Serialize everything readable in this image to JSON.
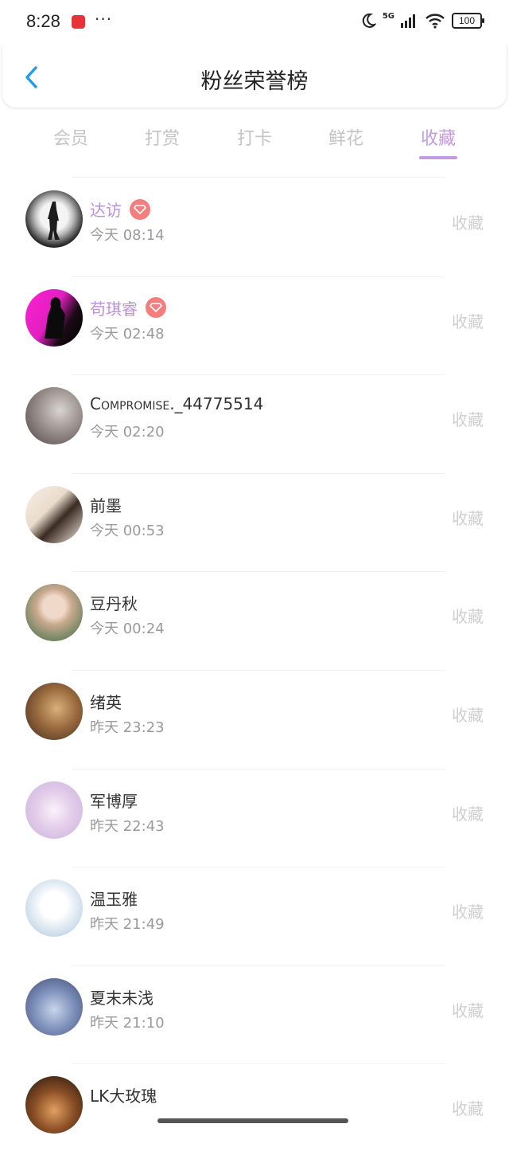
{
  "status_bar": {
    "time": "8:28",
    "more": "···",
    "network": "5G",
    "battery": "100"
  },
  "header": {
    "title": "粉丝荣誉榜"
  },
  "tabs": [
    {
      "label": "会员",
      "active": false
    },
    {
      "label": "打赏",
      "active": false
    },
    {
      "label": "打卡",
      "active": false
    },
    {
      "label": "鲜花",
      "active": false
    },
    {
      "label": "收藏",
      "active": true
    }
  ],
  "colors": {
    "accent": "#c39be0",
    "vip_name": "#bd8fdc",
    "badge": "#f47d7d",
    "back": "#1f9bea"
  },
  "fans": [
    {
      "name": "达访",
      "vip": true,
      "time": "今天 08:14",
      "action": "收藏",
      "avatar": "dark-figure"
    },
    {
      "name": "苟琪睿",
      "vip": true,
      "time": "今天 02:48",
      "action": "收藏",
      "avatar": "magenta-figure"
    },
    {
      "name": "Compromise._44775514",
      "vip": false,
      "time": "今天 02:20",
      "action": "收藏",
      "avatar": "grey-landscape"
    },
    {
      "name": "前墨",
      "vip": false,
      "time": "今天 00:53",
      "action": "收藏",
      "avatar": "anime-couple"
    },
    {
      "name": "豆丹秋",
      "vip": false,
      "time": "今天 00:24",
      "action": "收藏",
      "avatar": "girl-portrait"
    },
    {
      "name": "绪英",
      "vip": false,
      "time": "昨天 23:23",
      "action": "收藏",
      "avatar": "warm-portrait"
    },
    {
      "name": "军博厚",
      "vip": false,
      "time": "昨天 22:43",
      "action": "收藏",
      "avatar": "pastel-anime"
    },
    {
      "name": "温玉雅",
      "vip": false,
      "time": "昨天 21:49",
      "action": "收藏",
      "avatar": "chibi-girl"
    },
    {
      "name": "夏末未浅",
      "vip": false,
      "time": "昨天 21:10",
      "action": "收藏",
      "avatar": "blue-anime"
    },
    {
      "name": "LK大玫瑰",
      "vip": false,
      "time": "",
      "action": "收藏",
      "avatar": "dark-warm"
    }
  ]
}
